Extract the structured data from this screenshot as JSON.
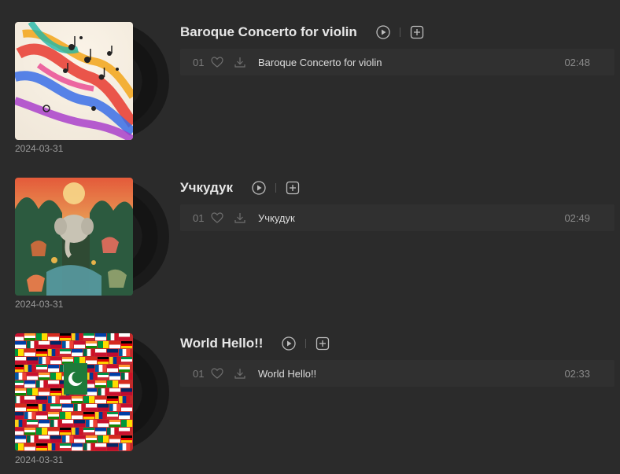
{
  "albums": [
    {
      "title": "Baroque Concerto for violin",
      "date": "2024-03-31",
      "cover_icon": "abstract-music-splash-art",
      "tracks": [
        {
          "number": "01",
          "title": "Baroque Concerto for violin",
          "duration": "02:48"
        }
      ]
    },
    {
      "title": "Учкудук",
      "date": "2024-03-31",
      "cover_icon": "jungle-elephant-art",
      "tracks": [
        {
          "number": "01",
          "title": "Учкудук",
          "duration": "02:49"
        }
      ]
    },
    {
      "title": "World Hello!!",
      "date": "2024-03-31",
      "cover_icon": "world-flags-collage-art",
      "tracks": [
        {
          "number": "01",
          "title": "World Hello!!",
          "duration": "02:33"
        }
      ]
    }
  ],
  "icons": {
    "play": "play-circle-icon",
    "add": "add-to-playlist-icon",
    "like": "heart-icon",
    "download": "download-icon"
  },
  "colors": {
    "background": "#2b2b2b",
    "row_background": "#303030",
    "title_text": "#e6e6e6",
    "muted_text": "#9a9a9a"
  }
}
